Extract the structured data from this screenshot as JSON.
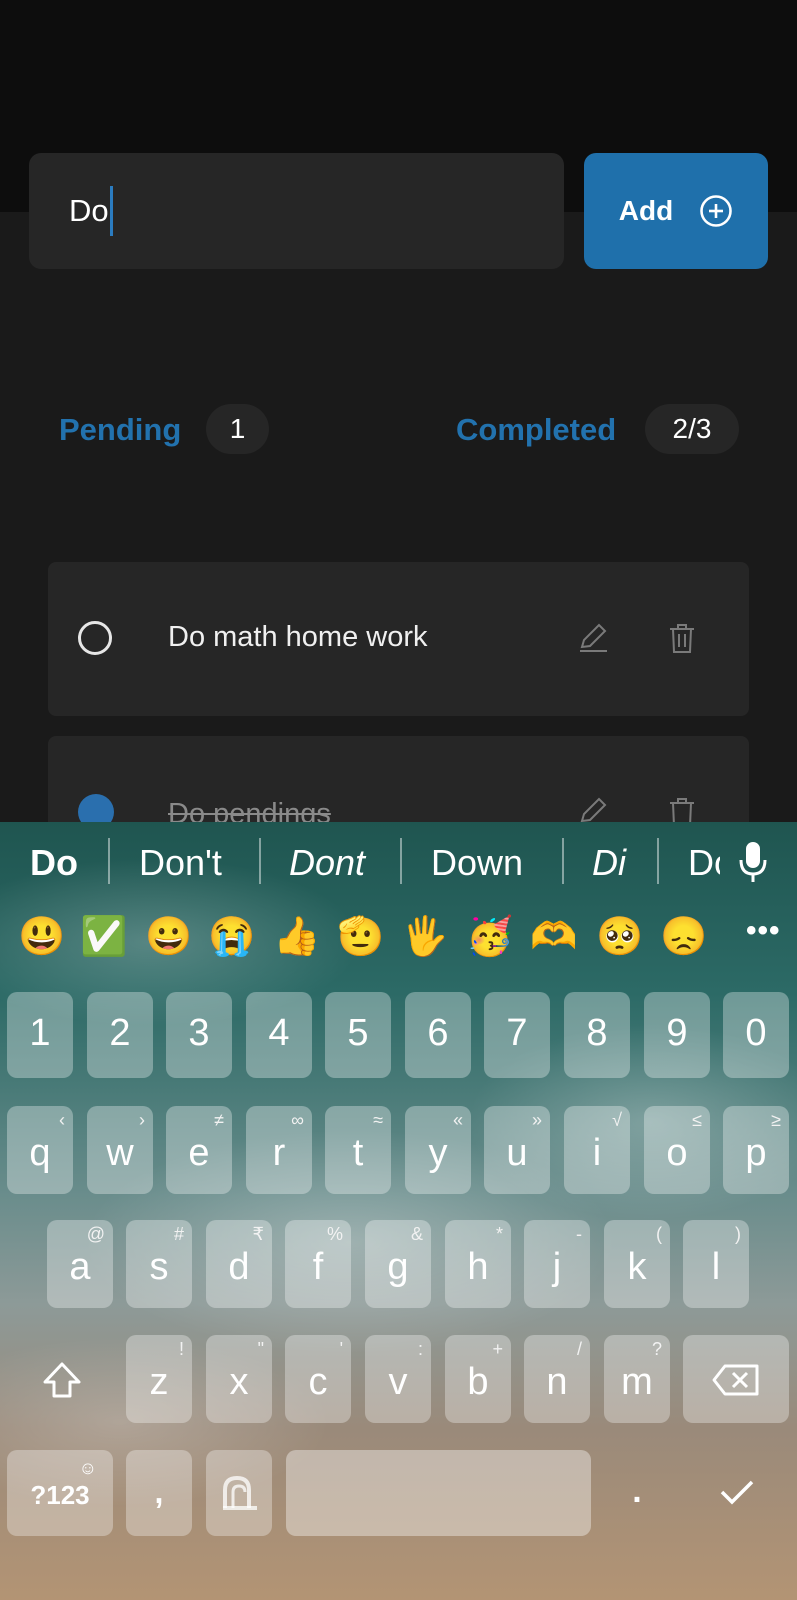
{
  "input": {
    "value": "Do"
  },
  "add_button": {
    "label": "Add"
  },
  "counters": {
    "pending_label": "Pending",
    "pending_count": "1",
    "completed_label": "Completed",
    "completed_count": "2/3"
  },
  "tasks": [
    {
      "text": "Do math home work",
      "done": false
    },
    {
      "text": "Do pendings",
      "done": true
    }
  ],
  "keyboard": {
    "suggestions": [
      "Do",
      "Don't",
      "Dont",
      "Down",
      "Di",
      "Do"
    ],
    "emojis": [
      "😃",
      "✅",
      "😀",
      "😭",
      "👍",
      "🫡",
      "🖐",
      "🥳",
      "🫶",
      "🥺",
      "😞"
    ],
    "more_label": "•••",
    "number_row": [
      "1",
      "2",
      "3",
      "4",
      "5",
      "6",
      "7",
      "8",
      "9",
      "0"
    ],
    "row1": [
      "q",
      "w",
      "e",
      "r",
      "t",
      "y",
      "u",
      "i",
      "o",
      "p"
    ],
    "row1_hints": [
      "‹",
      "›",
      "≠",
      "∞",
      "≈",
      "«",
      "»",
      "√",
      "≤",
      "≥"
    ],
    "row2": [
      "a",
      "s",
      "d",
      "f",
      "g",
      "h",
      "j",
      "k",
      "l"
    ],
    "row2_hints": [
      "@",
      "#",
      "₹",
      "%",
      "&",
      "*",
      "-",
      "(",
      ")"
    ],
    "row3": [
      "z",
      "x",
      "c",
      "v",
      "b",
      "n",
      "m"
    ],
    "row3_hints": [
      "!",
      "\"",
      "'",
      ":",
      "+",
      "/",
      "?"
    ],
    "symbols_label": "?123",
    "comma_label": ",",
    "period_label": "."
  }
}
